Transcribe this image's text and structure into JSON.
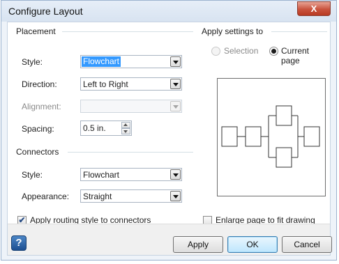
{
  "window": {
    "title": "Configure Layout",
    "close_label": "X"
  },
  "placement": {
    "group_label": "Placement",
    "style": {
      "label": "Style:",
      "value": "Flowchart"
    },
    "direction": {
      "label": "Direction:",
      "value": "Left to Right"
    },
    "alignment": {
      "label": "Alignment:",
      "value": ""
    },
    "spacing": {
      "label": "Spacing:",
      "value": "0.5 in."
    }
  },
  "connectors": {
    "group_label": "Connectors",
    "style": {
      "label": "Style:",
      "value": "Flowchart"
    },
    "appearance": {
      "label": "Appearance:",
      "value": "Straight"
    },
    "routing_checkbox": {
      "label": "Apply routing style to connectors",
      "checked": true
    }
  },
  "apply_settings": {
    "group_label": "Apply settings to",
    "options": [
      {
        "label": "Selection",
        "selected": false,
        "enabled": false
      },
      {
        "label": "Current page",
        "selected": true,
        "enabled": true
      }
    ]
  },
  "enlarge_checkbox": {
    "label": "Enlarge page to fit drawing",
    "checked": false
  },
  "buttons": {
    "apply": "Apply",
    "ok": "OK",
    "cancel": "Cancel",
    "help": "?"
  },
  "colors": {
    "accent_selection": "#3399ff",
    "close_button": "#c9533d",
    "help_button": "#1c4f91"
  },
  "icons": [
    "close-icon",
    "dropdown-arrow-icon",
    "spin-up-icon",
    "spin-down-icon",
    "help-icon",
    "check-icon"
  ]
}
